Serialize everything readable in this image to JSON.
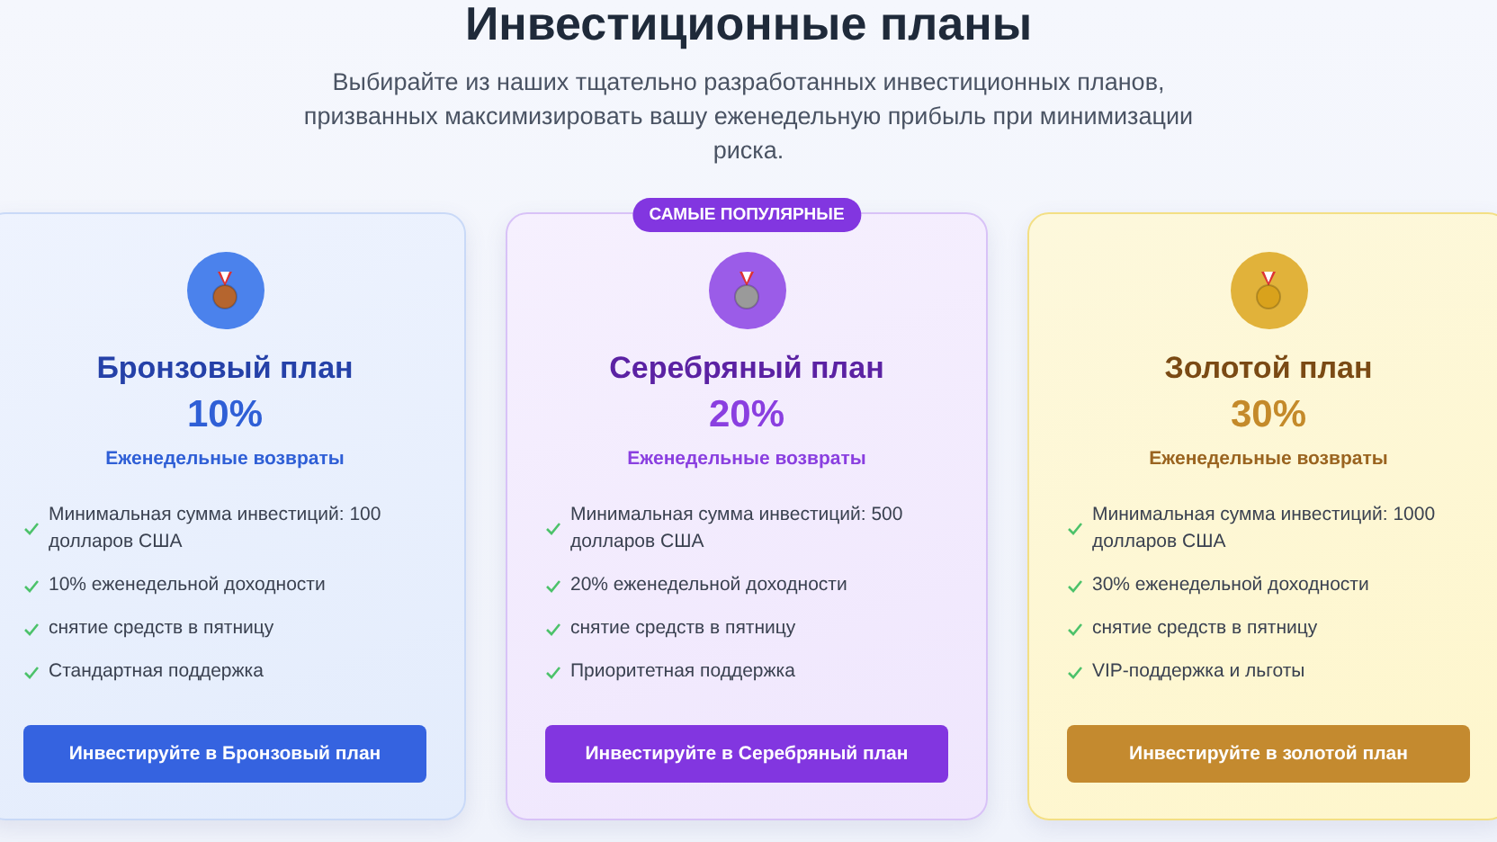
{
  "header": {
    "title": "Инвестиционные планы",
    "subtitle": "Выбирайте из наших тщательно разработанных инвестиционных планов, призванных максимизировать вашу еженедельную прибыль при минимизации риска."
  },
  "plans": [
    {
      "kind": "bronze",
      "name": "Бронзовый план",
      "rate": "10%",
      "period": "Еженедельные возвраты",
      "features": [
        "Минимальная сумма инвестиций: 100 долларов США",
        "10% еженедельной доходности",
        "снятие средств в пятницу",
        "Стандартная поддержка"
      ],
      "button": "Инвестируйте в Бронзовый план"
    },
    {
      "kind": "silver",
      "badge": "САМЫЕ ПОПУЛЯРНЫЕ",
      "name": "Серебряный план",
      "rate": "20%",
      "period": "Еженедельные возвраты",
      "features": [
        "Минимальная сумма инвестиций: 500 долларов США",
        "20% еженедельной доходности",
        "снятие средств в пятницу",
        "Приоритетная поддержка"
      ],
      "button": "Инвестируйте в Серебряный план"
    },
    {
      "kind": "gold",
      "name": "Золотой план",
      "rate": "30%",
      "period": "Еженедельные возвраты",
      "features": [
        "Минимальная сумма инвестиций: 1000 долларов США",
        "30% еженедельной доходности",
        "снятие средств в пятницу",
        "VIP-поддержка и льготы"
      ],
      "button": "Инвестируйте в золотой план"
    }
  ]
}
